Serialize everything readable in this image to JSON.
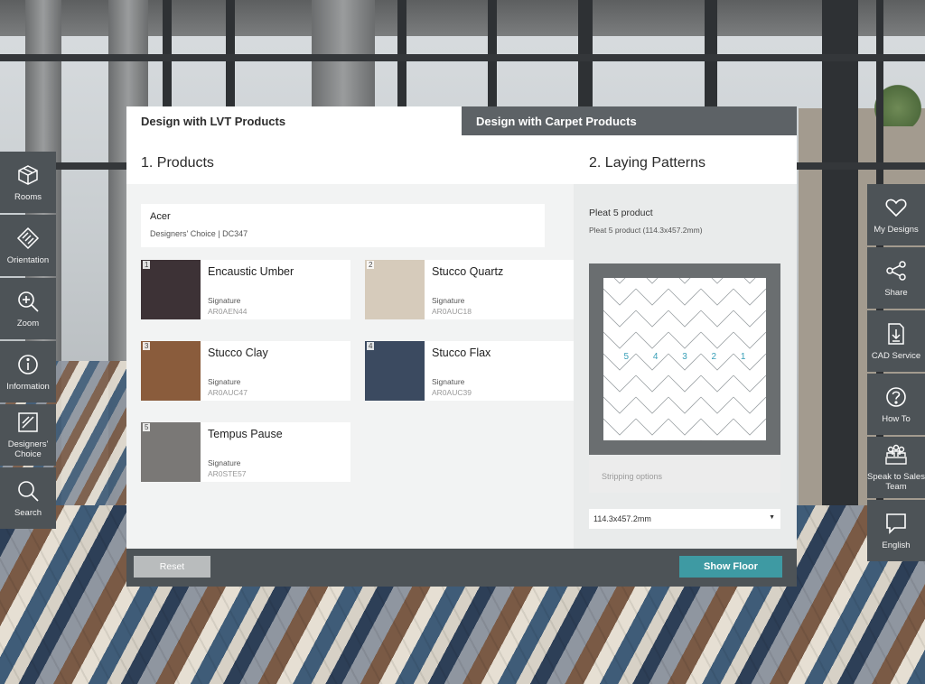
{
  "tabs": [
    {
      "label": "Design with LVT Products",
      "active": true
    },
    {
      "label": "Design with Carpet Products",
      "active": false
    }
  ],
  "products_section": {
    "title": "1. Products",
    "range": {
      "name": "Acer",
      "subtitle": "Designers' Choice | DC347"
    },
    "items": [
      {
        "number": "1",
        "name": "Encaustic Umber",
        "collection": "Signature",
        "code": "AR0AEN44",
        "swatch_color": "#3d3236"
      },
      {
        "number": "2",
        "name": "Stucco Quartz",
        "collection": "Signature",
        "code": "AR0AUC18",
        "swatch_color": "#d6cbbb"
      },
      {
        "number": "3",
        "name": "Stucco Clay",
        "collection": "Signature",
        "code": "AR0AUC47",
        "swatch_color": "#8a5c3c"
      },
      {
        "number": "4",
        "name": "Stucco Flax",
        "collection": "Signature",
        "code": "AR0AUC39",
        "swatch_color": "#3b4a60"
      },
      {
        "number": "5",
        "name": "Tempus Pause",
        "collection": "Signature",
        "code": "AR0STE57",
        "swatch_color": "#7a7876"
      }
    ]
  },
  "patterns_section": {
    "title": "2. Laying Patterns",
    "pattern_name": "Pleat 5 product",
    "pattern_description": "Pleat 5 product (114.3x457.2mm)",
    "sequence": "5 4 3 2 1",
    "stripping_placeholder": "Stripping options",
    "size_select": "114.3x457.2mm"
  },
  "footer": {
    "reset_label": "Reset",
    "show_floor_label": "Show Floor"
  },
  "left_toolbar": [
    {
      "label": "Rooms",
      "icon": "cube-icon"
    },
    {
      "label": "Orientation",
      "icon": "orientation-icon"
    },
    {
      "label": "Zoom",
      "icon": "zoom-in-icon"
    },
    {
      "label": "Information",
      "icon": "info-icon"
    },
    {
      "label": "Designers' Choice",
      "icon": "designers-choice-icon"
    },
    {
      "label": "Search",
      "icon": "search-icon"
    }
  ],
  "right_toolbar": [
    {
      "label": "My Designs",
      "icon": "heart-icon"
    },
    {
      "label": "Share",
      "icon": "share-icon"
    },
    {
      "label": "CAD Service",
      "icon": "download-file-icon"
    },
    {
      "label": "How To",
      "icon": "question-icon"
    },
    {
      "label": "Speak to Sales Team",
      "icon": "team-icon"
    },
    {
      "label": "English",
      "icon": "speech-bubble-icon"
    }
  ],
  "colors": {
    "toolbar_bg": "#4d5357",
    "accent": "#3e9aa3",
    "pattern_number": "#3aa0b8"
  }
}
